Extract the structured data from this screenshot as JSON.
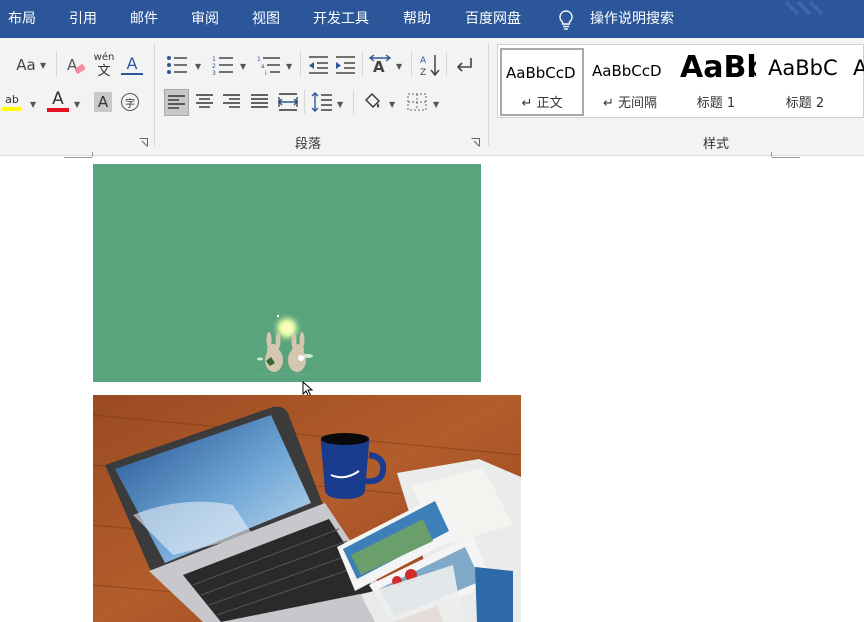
{
  "tabs": {
    "items": [
      "布局",
      "引用",
      "邮件",
      "审阅",
      "视图",
      "开发工具",
      "帮助",
      "百度网盘"
    ],
    "tell_me": "操作说明搜索"
  },
  "ribbon": {
    "font_group": {
      "change_case_label": "Aa",
      "phonetic_label": "wén",
      "phonetic_char": "文",
      "text_effect_label": "A",
      "highlight_label": "ab",
      "font_color_label": "A",
      "char_shading_label": "A",
      "enclose_char_label": "字"
    },
    "paragraph_group": {
      "label": "段落"
    },
    "styles_group": {
      "label": "样式",
      "items": [
        {
          "preview": "AaBbCcD",
          "name": "↵ 正文"
        },
        {
          "preview": "AaBbCcD",
          "name": "↵ 无间隔"
        },
        {
          "preview": "AaBb",
          "name": "标题 1"
        },
        {
          "preview": "AaBbC",
          "name": "标题 2"
        },
        {
          "preview": "A",
          "name": ""
        }
      ]
    }
  },
  "colors": {
    "title_bar": "#2b579a",
    "ribbon_bg": "#f3f3f3",
    "highlight_yellow": "#ffff00",
    "font_color_red": "#e81123",
    "green_image": "#5aa47d"
  },
  "document": {
    "images": [
      "green-animated-image",
      "laptop-coffee-maps-photo"
    ]
  }
}
